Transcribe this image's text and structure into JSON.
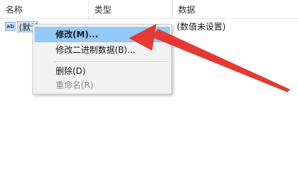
{
  "columns": {
    "name": "名称",
    "type": "类型",
    "data": "数据"
  },
  "row": {
    "icon": "ab",
    "name": "(默认)",
    "data": "(数值未设置)"
  },
  "menu": {
    "items": [
      {
        "label": "修改(M)...",
        "state": "highlighted"
      },
      {
        "label": "修改二进制数据(B)...",
        "state": "normal"
      },
      {
        "label": "删除(D)",
        "state": "normal"
      },
      {
        "label": "重命名(R)",
        "state": "disabled"
      }
    ]
  },
  "colors": {
    "highlight": "#91c9f7",
    "arrow": "#e53935"
  }
}
